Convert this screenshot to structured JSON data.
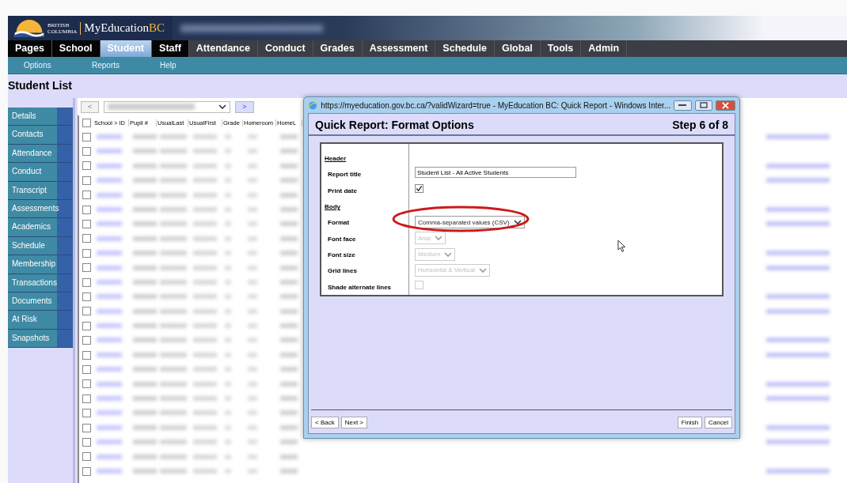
{
  "brand": {
    "line1": "BRITISH",
    "line2": "COLUMBIA",
    "name": "MyEducation",
    "suffix": "BC"
  },
  "nav": [
    {
      "label": "Pages",
      "selected": false
    },
    {
      "label": "School",
      "selected": false
    },
    {
      "label": "Student",
      "selected": true
    },
    {
      "label": "Staff",
      "selected": false
    },
    {
      "label": "Attendance",
      "selected": false
    },
    {
      "label": "Conduct",
      "selected": false
    },
    {
      "label": "Grades",
      "selected": false
    },
    {
      "label": "Assessment",
      "selected": false
    },
    {
      "label": "Schedule",
      "selected": false
    },
    {
      "label": "Global",
      "selected": false
    },
    {
      "label": "Tools",
      "selected": false
    },
    {
      "label": "Admin",
      "selected": false
    }
  ],
  "subnav": [
    "Options",
    "Reports",
    "Help"
  ],
  "page_title": "Student List",
  "sidebar": {
    "items": [
      {
        "label": "Details",
        "selected": false
      },
      {
        "label": "Contacts",
        "selected": false
      },
      {
        "label": "Attendance",
        "selected": false
      },
      {
        "label": "Conduct",
        "selected": false
      },
      {
        "label": "Transcript",
        "selected": false
      },
      {
        "label": "Assessments",
        "selected": false
      },
      {
        "label": "Academics",
        "selected": false
      },
      {
        "label": "Schedule",
        "selected": false
      },
      {
        "label": "Membership",
        "selected": false
      },
      {
        "label": "Transactions",
        "selected": false
      },
      {
        "label": "Documents",
        "selected": false
      },
      {
        "label": "At Risk",
        "selected": false
      },
      {
        "label": "Snapshots",
        "selected": false
      }
    ]
  },
  "table": {
    "prev": "<",
    "next": ">",
    "select_all": {
      "checked": false
    },
    "columns": [
      "School > ID",
      "Pupil #",
      "UsualLast",
      "UsualFirst",
      "Grade",
      "Homeroom",
      "HomeL"
    ],
    "rows": [
      {
        "checked": false
      },
      {
        "checked": false
      },
      {
        "checked": false
      },
      {
        "checked": false
      },
      {
        "checked": false
      },
      {
        "checked": false
      },
      {
        "checked": false
      },
      {
        "checked": false
      },
      {
        "checked": false
      },
      {
        "checked": false
      },
      {
        "checked": false
      },
      {
        "checked": false
      },
      {
        "checked": false
      },
      {
        "checked": false
      },
      {
        "checked": false
      },
      {
        "checked": false
      },
      {
        "checked": false
      },
      {
        "checked": false
      },
      {
        "checked": false
      },
      {
        "checked": false
      },
      {
        "checked": false
      },
      {
        "checked": false
      },
      {
        "checked": false
      },
      {
        "checked": false
      }
    ]
  },
  "dialog": {
    "title": "https://myeducation.gov.bc.ca/?validWizard=true - MyEducation BC: Quick Report - Windows Inter...",
    "heading": "Quick Report: Format Options",
    "step": "Step 6 of 8",
    "rows": [
      {
        "kind": "section",
        "label": "Header"
      },
      {
        "kind": "text",
        "label": "Report title",
        "value": "Student List - All Active Students",
        "disabled": false
      },
      {
        "kind": "checkbox",
        "label": "Print date",
        "checked": true,
        "disabled": false
      },
      {
        "kind": "section",
        "label": "Body"
      },
      {
        "kind": "select",
        "label": "Format",
        "value": "Comma-separated values (CSV)",
        "disabled": false,
        "highlighted": true
      },
      {
        "kind": "select",
        "label": "Font face",
        "value": "Arial",
        "disabled": true,
        "highlighted": false
      },
      {
        "kind": "select",
        "label": "Font size",
        "value": "Medium",
        "disabled": true,
        "highlighted": false
      },
      {
        "kind": "select",
        "label": "Grid lines",
        "value": "Horizontal & Vertical",
        "disabled": true,
        "highlighted": false
      },
      {
        "kind": "checkbox",
        "label": "Shade alternate lines",
        "checked": false,
        "disabled": true
      }
    ],
    "buttons_left": [
      "< Back",
      "Next >"
    ],
    "buttons_right": [
      "Finish",
      "Cancel"
    ]
  }
}
